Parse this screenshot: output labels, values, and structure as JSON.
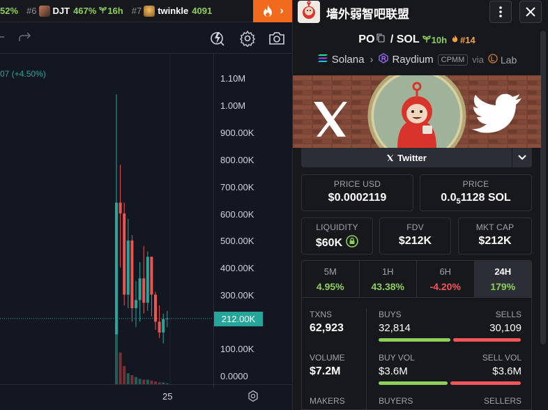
{
  "ticker": {
    "items": [
      {
        "rank": "",
        "symbol": "",
        "pct": "52%",
        "age": ""
      },
      {
        "rank": "#6",
        "symbol": "DJT",
        "pct": "467%",
        "age": "16h"
      },
      {
        "rank": "#7",
        "symbol": "twinkle",
        "pct": "4091",
        "age": ""
      }
    ]
  },
  "chart": {
    "change_label": "07 (+4.50%)",
    "y_ticks": [
      "1.10M",
      "1.00M",
      "900.00K",
      "800.00K",
      "700.00K",
      "600.00K",
      "500.00K",
      "400.00K",
      "300.00K",
      "212.00K",
      "100.00K",
      "0.0000"
    ],
    "current_price_tag": "212.00K",
    "x_tick": "25",
    "colors": {
      "up": "#26a69a",
      "down": "#ef5350"
    }
  },
  "chart_data": {
    "type": "candlestick",
    "ylim": [
      0,
      1100000
    ],
    "candles": [
      {
        "o": 100000,
        "h": 1040000,
        "l": 90000,
        "c": 640000,
        "up": true
      },
      {
        "o": 640000,
        "h": 780000,
        "l": 400000,
        "c": 600000,
        "up": false
      },
      {
        "o": 600000,
        "h": 640000,
        "l": 260000,
        "c": 300000,
        "up": false
      },
      {
        "o": 300000,
        "h": 580000,
        "l": 250000,
        "c": 500000,
        "up": true
      },
      {
        "o": 500000,
        "h": 520000,
        "l": 200000,
        "c": 250000,
        "up": false
      },
      {
        "o": 250000,
        "h": 350000,
        "l": 180000,
        "c": 280000,
        "up": true
      },
      {
        "o": 280000,
        "h": 420000,
        "l": 200000,
        "c": 360000,
        "up": true
      },
      {
        "o": 360000,
        "h": 480000,
        "l": 230000,
        "c": 270000,
        "up": false
      },
      {
        "o": 270000,
        "h": 460000,
        "l": 240000,
        "c": 440000,
        "up": true
      },
      {
        "o": 440000,
        "h": 440000,
        "l": 220000,
        "c": 300000,
        "up": false
      },
      {
        "o": 300000,
        "h": 310000,
        "l": 170000,
        "c": 200000,
        "up": false
      },
      {
        "o": 200000,
        "h": 260000,
        "l": 140000,
        "c": 160000,
        "up": false
      },
      {
        "o": 160000,
        "h": 230000,
        "l": 120000,
        "c": 210000,
        "up": true
      },
      {
        "o": 210000,
        "h": 240000,
        "l": 180000,
        "c": 212000,
        "up": true
      }
    ],
    "volume": [
      0.55,
      0.35,
      0.2,
      0.12,
      0.1,
      0.08,
      0.06,
      0.05,
      0.05,
      0.04,
      0.03,
      0.02,
      0.02,
      0.01
    ]
  },
  "panel": {
    "title": "墙外弱智吧联盟",
    "pair_base": "PO",
    "pair_sep": " / ",
    "pair_quote": "SOL",
    "pair_age": "10h",
    "pair_rank": "#14",
    "chain": "Solana",
    "dex": "Raydium",
    "dex_badge": "CPMM",
    "via": "via",
    "via_source": "Lab",
    "social_label": "Twitter",
    "price_usd_label": "PRICE USD",
    "price_usd": "$0.0002119",
    "price_sol_label": "PRICE",
    "price_sol_prefix": "0.0",
    "price_sol_sub": "5",
    "price_sol_rest": "1128 SOL",
    "liquidity_label": "LIQUIDITY",
    "liquidity": "$60K",
    "fdv_label": "FDV",
    "fdv": "$212K",
    "mktcap_label": "MKT CAP",
    "mktcap": "$212K",
    "timeframes": [
      {
        "label": "5M",
        "value": "4.95%",
        "cls": "green"
      },
      {
        "label": "1H",
        "value": "43.38%",
        "cls": "green"
      },
      {
        "label": "6H",
        "value": "-4.20%",
        "cls": "red"
      },
      {
        "label": "24H",
        "value": "179%",
        "cls": "green"
      }
    ],
    "txns_label": "TXNS",
    "txns": "62,923",
    "buys_label": "BUYS",
    "buys": "32,814",
    "sells_label": "SELLS",
    "sells": "30,109",
    "buys_fraction": 0.52,
    "volume_label": "VOLUME",
    "volume": "$7.2M",
    "buy_vol_label": "BUY VOL",
    "buy_vol": "$3.6M",
    "sell_vol_label": "SELL VOL",
    "sell_vol": "$3.6M",
    "buy_vol_fraction": 0.5,
    "makers_label": "MAKERS",
    "buyers_label": "BUYERS",
    "sellers_label": "SELLERS"
  }
}
